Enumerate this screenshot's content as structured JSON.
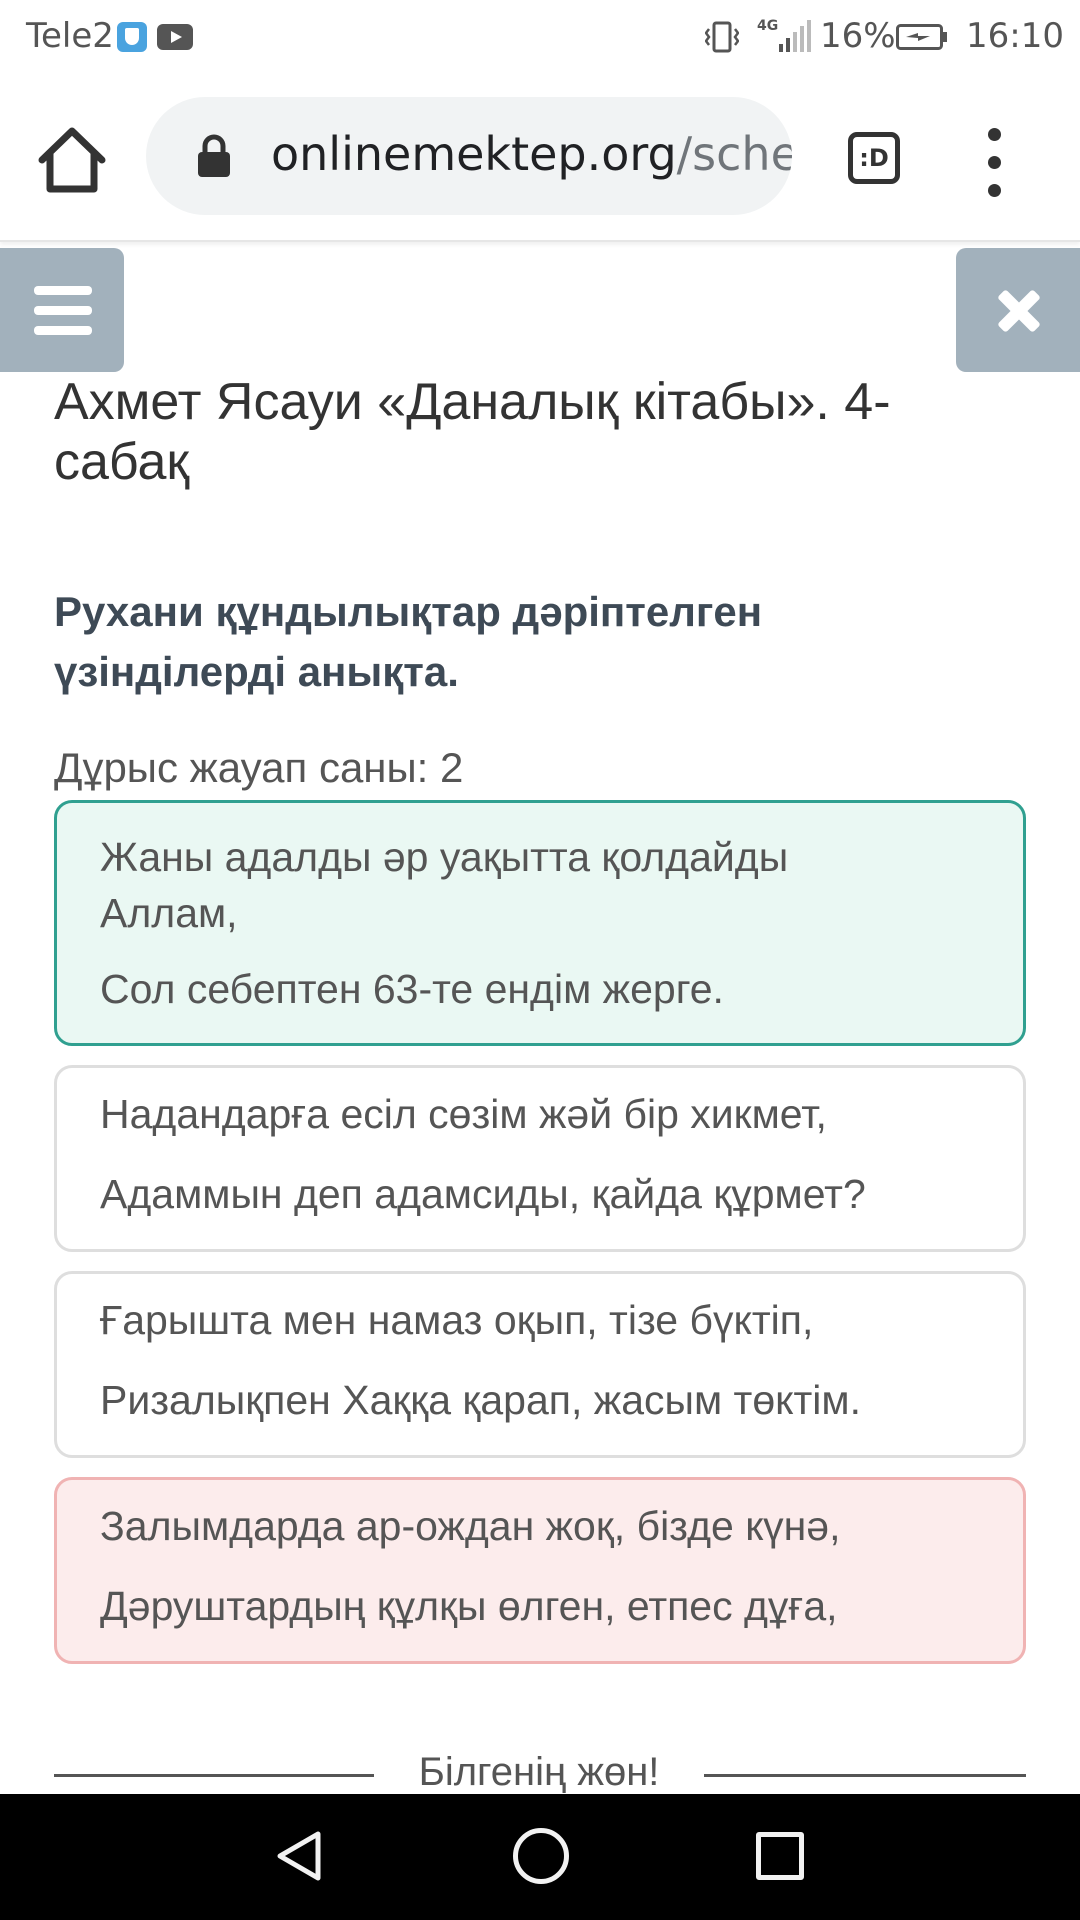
{
  "status_bar": {
    "carrier": "Tele2",
    "network": "4G",
    "battery": "16%",
    "time": "16:10",
    "icons": [
      "shield-icon",
      "youtube-icon",
      "vibrate-icon",
      "signal-icon",
      "battery-charging-icon"
    ]
  },
  "browser": {
    "url_domain": "onlinemektep.org",
    "url_path": "/sche",
    "tab_switcher_label": ":D",
    "icons": [
      "home-icon",
      "lock-icon",
      "menu-dots-icon"
    ]
  },
  "page": {
    "title": "Ахмет Ясауи «Даналық кітабы». 4-сабақ",
    "question": "Рухани құндылықтар дәріптелген үзінділерді анықта.",
    "answer_count": "Дұрыс жауап саны: 2",
    "options": [
      {
        "lines": [
          "Жаны адалды әр уақытта қолдайды Аллам,",
          "Сол себептен 63-те ендім жерге."
        ],
        "state": "correct"
      },
      {
        "lines": [
          "Надандарға есіл сөзім жәй бір хикмет,",
          "Адаммын деп адамсиды, қайда құрмет?"
        ],
        "state": "neutral"
      },
      {
        "lines": [
          "Ғарышта мен намаз оқып, тізе бүктіп,",
          "Ризалықпен Хаққа қарап, жасым төктім."
        ],
        "state": "neutral"
      },
      {
        "lines": [
          "Залымдарда ар-ождан жоқ, бізде күнә,",
          "Дәруштардың құлқы өлген, етпес дұға,"
        ],
        "state": "wrong"
      }
    ],
    "section_divider": "Білгенің жөн!"
  },
  "colors": {
    "menu_button_bg": "#a2b1bc",
    "correct_border": "#30a090",
    "correct_bg": "#eaf8f3",
    "wrong_border": "#f0b3b3",
    "wrong_bg": "#fcecec",
    "question_text": "#3e4a56"
  },
  "nav_bar": {
    "icons": [
      "back-triangle-icon",
      "home-circle-icon",
      "recents-square-icon"
    ]
  }
}
